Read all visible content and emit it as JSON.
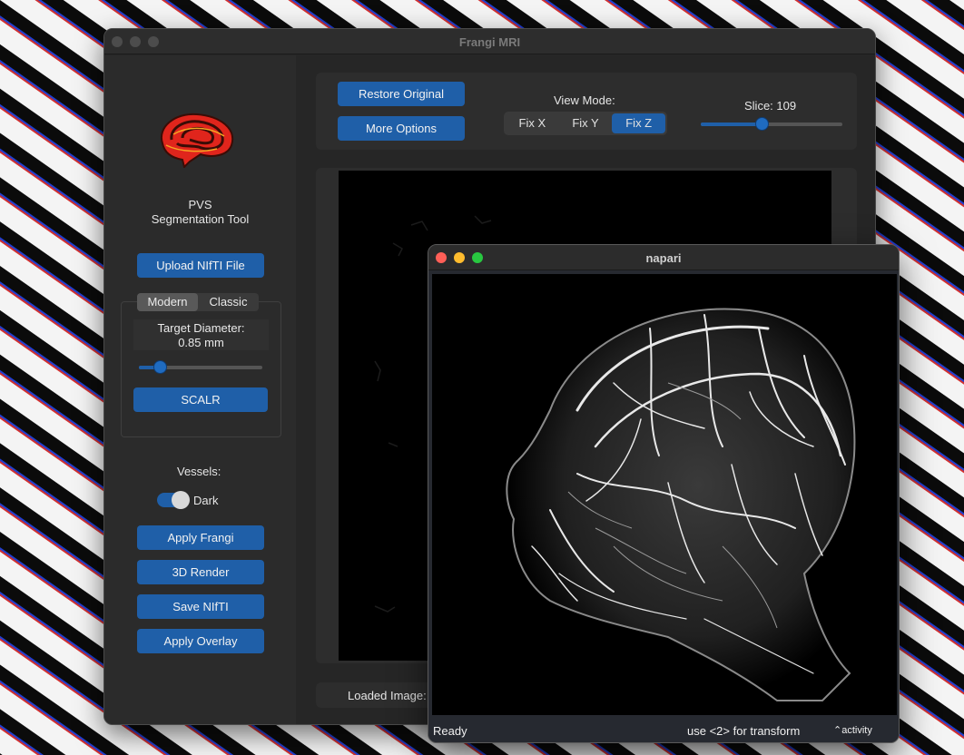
{
  "main_window": {
    "title": "Frangi MRI",
    "sidebar": {
      "app_name_line1": "PVS",
      "app_name_line2": "Segmentation Tool",
      "upload_button": "Upload NIfTI File",
      "mode_tabs": [
        "Modern",
        "Classic"
      ],
      "active_mode": "Modern",
      "target_diameter_label": "Target Diameter:",
      "target_diameter_value": "0.85 mm",
      "diameter_slider_fraction": 0.17,
      "scalr_button": "SCALR",
      "vessels_label": "Vessels:",
      "vessels_toggle_label": "Dark",
      "vessels_toggle_on": true,
      "apply_frangi_button": "Apply Frangi",
      "render_3d_button": "3D Render",
      "save_nifti_button": "Save NIfTI",
      "apply_overlay_button": "Apply Overlay"
    },
    "toolbar": {
      "restore_button": "Restore Original",
      "more_options_button": "More Options",
      "view_mode_label": "View Mode:",
      "view_modes": [
        "Fix X",
        "Fix Y",
        "Fix Z"
      ],
      "active_view_mode": "Fix Z",
      "slice_label": "Slice: 109",
      "slice_fraction": 0.43
    },
    "status": {
      "loaded_image_label": "Loaded Image:"
    }
  },
  "napari_window": {
    "title": "napari",
    "status_ready": "Ready",
    "status_hint": "use <2> for transform",
    "activity_label": "activity"
  },
  "colors": {
    "accent": "#1f5fa8",
    "window_bg": "#262626",
    "close": "#ff5f57",
    "minimize": "#febc2e",
    "zoom": "#28c840"
  }
}
